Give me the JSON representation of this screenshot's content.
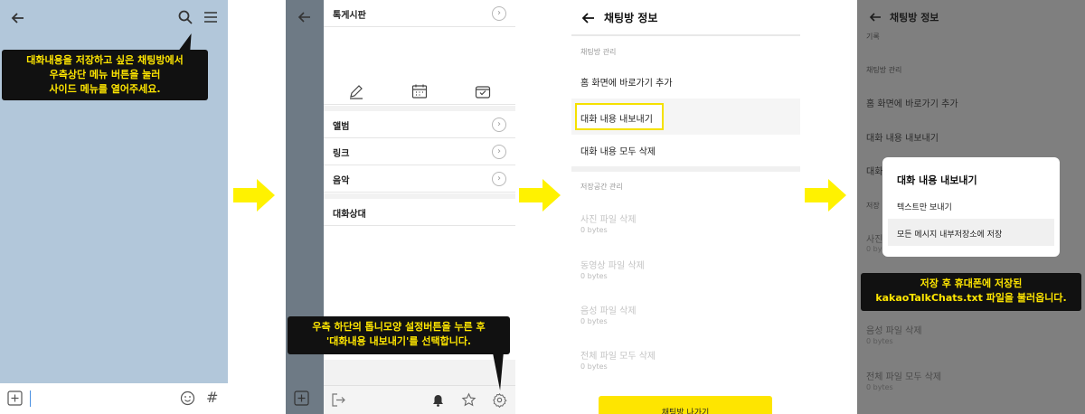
{
  "instructions": {
    "step1": [
      "대화내용을 저장하고 싶은 채팅방에서",
      "우측상단 메뉴 버튼을 눌러",
      "사이드 메뉴를 열어주세요."
    ],
    "step2": [
      "우측 하단의 톱니모양 설정버튼을 누른 후",
      "'대화내용 내보내기'를 선택합니다."
    ],
    "step4": [
      "저장 후 휴대폰에 저장된",
      "kakaoTalkChats.txt 파일을 불러옵니다."
    ]
  },
  "panel1": {
    "icons": [
      "back-arrow-icon",
      "search-icon",
      "menu-icon",
      "plus-box-icon",
      "emoji-icon",
      "hash-icon"
    ],
    "hash_glyph": "#"
  },
  "panel2": {
    "menu_items": {
      "bulletin": "톡게시판",
      "album": "앨범",
      "link": "링크",
      "music": "음악",
      "conversation_partner": "대화상대"
    },
    "chevron": "›"
  },
  "panel3": {
    "title": "채팅방 정보",
    "section_chat_manage": "채팅방 관리",
    "add_home_shortcut": "홈 화면에 바로가기 추가",
    "export_chat": "대화 내용 내보내기",
    "delete_all_chat": "대화 내용 모두 삭제",
    "section_storage": "저장공간 관리",
    "delete_photos": "사진 파일 삭제",
    "delete_videos": "동영상 파일 삭제",
    "delete_audio": "음성 파일 삭제",
    "delete_all_files": "전체 파일 모두 삭제",
    "size_zero": "0 bytes",
    "leave_button": "채팅방 나가기"
  },
  "panel4": {
    "title": "채팅방 정보",
    "cut_top_text": "기록",
    "section_chat_manage": "채팅방 관리",
    "add_home_shortcut": "홈 화면에 바로가기 추가",
    "export_chat": "대화 내용 내보내기",
    "export_partial": "대화",
    "section_partial": "저장",
    "photos_partial": "사진",
    "size_partial": "0 by",
    "delete_audio": "음성 파일 삭제",
    "delete_all_files": "전체 파일 모두 삭제",
    "size_zero": "0 bytes",
    "modal": {
      "title": "대화 내용 내보내기",
      "option_text_only": "텍스트만 보내기",
      "option_save_all": "모든 메시지 내부저장소에 저장"
    }
  },
  "colors": {
    "chat_bg": "#b2c7da",
    "callout_bg": "#111111",
    "callout_text": "#ffe600",
    "arrow_yellow": "#fff200",
    "kakao_yellow": "#fee500",
    "dim_overlay": "#7f7f7f"
  }
}
